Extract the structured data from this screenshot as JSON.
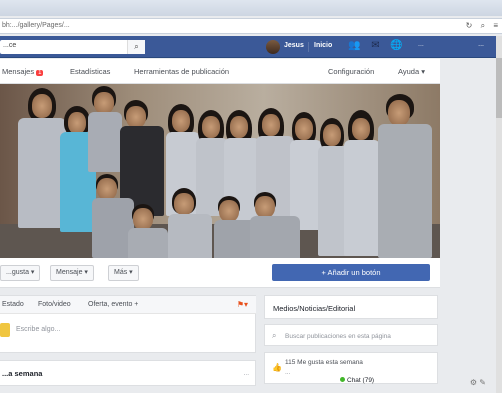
{
  "browser": {
    "url": "bh:.../gallery/Pages/...",
    "icons": [
      "reload-icon",
      "search-icon",
      "menu-icon"
    ]
  },
  "topbar": {
    "search_value": "...ce",
    "user_name": "Jesus",
    "home_label": "Inicio",
    "help_label": "...",
    "menu_label": "..."
  },
  "page_nav": {
    "items": [
      {
        "label": "Mensajes",
        "badge": "1"
      },
      {
        "label": "Estadísticas"
      },
      {
        "label": "Herramientas de publicación"
      },
      {
        "label": "Configuración"
      },
      {
        "label": "Ayuda ▾"
      }
    ]
  },
  "actions": {
    "liked_label": "...gusta ▾",
    "message_label": "Mensaje ▾",
    "more_label": "Más ▾",
    "cta_label": "+ Añadir un botón"
  },
  "composer": {
    "tabs": [
      "Estado",
      "Foto/video",
      "Oferta, evento +"
    ],
    "placeholder": "Escribe algo..."
  },
  "week": {
    "title": "...a semana",
    "range": "..."
  },
  "right": {
    "about_title": "Medios/Noticias/Editorial",
    "search_placeholder": "Buscar publicaciones en esta página",
    "likes_line1": "115 Me gusta esta semana",
    "likes_line2": "...",
    "chat_label": "Chat (79)"
  },
  "colors": {
    "fb_blue": "#3b5998",
    "cta_blue": "#4267b2",
    "badge_red": "#fa3e3e"
  }
}
